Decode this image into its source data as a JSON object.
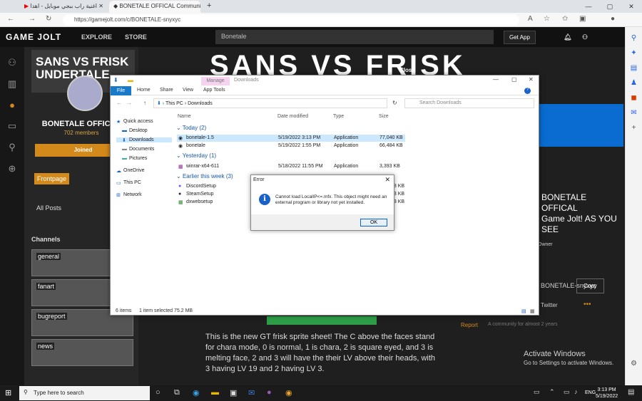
{
  "browser": {
    "tabs": [
      {
        "label": "اغنية راب ببجي موبايل - اهدا"
      },
      {
        "label": "BONETALE OFFICAL Community"
      }
    ],
    "url": "https://gamejolt.com/c/BONETALE-snyxyc",
    "new_tab": "+",
    "window_controls": [
      "—",
      "▢",
      "✕"
    ]
  },
  "gamejolt": {
    "logo": "GAME JOLT",
    "explore": "EXPLORE",
    "store": "STORE",
    "search_placeholder": "Bonetale",
    "get_app": "Get App",
    "channel_banner": "SANS VS FRISK UNDERTALE",
    "hero_banner": "SANS VS FRISK",
    "channel_name": "BONETALE OFFICAL",
    "members": "702 members",
    "joined": "Joined",
    "frontpage": "Frontpage",
    "all_posts": "All Posts",
    "channels_heading": "Channels",
    "channels": [
      "general",
      "fanart",
      "bugreport",
      "news"
    ],
    "close": "Close",
    "right_title": "BONETALE OFFICAL\nGame Jolt! AS YOU SEE",
    "owner": "Owner",
    "share_url": "BONETALE-snyxyc",
    "copy": "Copy",
    "twitter": "Twitter",
    "more": "•••",
    "report": "Report",
    "community_age": "A community for almost 2 years",
    "post_text": "This is the new GT frisk sprite sheet! The C above the faces stand for chara mode, 0 is normal, 1 is chara, 2 is square eyed, and 3 is melting face, 2 and 3 will have the their LV above their heads, with 3 having LV 19 and 2 having LV 3.",
    "activate_title": "Activate Windows",
    "activate_sub": "Go to Settings to activate Windows."
  },
  "explorer": {
    "context_tab": "Manage",
    "title": "Downloads",
    "ribbon": [
      "File",
      "Home",
      "Share",
      "View",
      "App Tools"
    ],
    "path": [
      "This PC",
      "Downloads"
    ],
    "search_placeholder": "Search Downloads",
    "nav": [
      {
        "label": "Quick access",
        "icon": "star-icon"
      },
      {
        "label": "Desktop",
        "icon": "folder-icon"
      },
      {
        "label": "Downloads",
        "icon": "download-icon",
        "selected": true
      },
      {
        "label": "Documents",
        "icon": "folder-icon"
      },
      {
        "label": "Pictures",
        "icon": "folder-icon"
      },
      {
        "label": "OneDrive",
        "icon": "cloud-icon"
      },
      {
        "label": "This PC",
        "icon": "computer-icon"
      },
      {
        "label": "Network",
        "icon": "network-icon"
      }
    ],
    "columns": [
      "Name",
      "Date modified",
      "Type",
      "Size"
    ],
    "groups": [
      {
        "label": "Today (2)",
        "files": [
          {
            "name": "bonetale-1.5",
            "date": "5/19/2022 3:13 PM",
            "type": "Application",
            "size": "77,040 KB",
            "selected": true
          },
          {
            "name": "bonetale",
            "date": "5/19/2022 1:55 PM",
            "type": "Application",
            "size": "66,484 KB"
          }
        ]
      },
      {
        "label": "Yesterday (1)",
        "files": [
          {
            "name": "winrar-x64-611",
            "date": "5/18/2022 11:55 PM",
            "type": "Application",
            "size": "3,393 KB"
          }
        ]
      },
      {
        "label": "Earlier this week (3)",
        "files": [
          {
            "name": "DiscordSetup",
            "date": "",
            "type": "",
            "size": "48 KB"
          },
          {
            "name": "SteamSetup",
            "date": "",
            "type": "",
            "size": "93 KB"
          },
          {
            "name": "dxwebsetup",
            "date": "",
            "type": "",
            "size": "93 KB"
          }
        ]
      }
    ],
    "status_items": "6 items",
    "status_selected": "1 item selected  75.2 MB"
  },
  "error": {
    "title": "Error",
    "message": "Cannot load LocalIP<=.mfx. This object might need an external program or library not yet installed.",
    "ok": "OK"
  },
  "taskbar": {
    "search_placeholder": "Type here to search",
    "lang": "ENG",
    "time": "3:13 PM",
    "date": "5/19/2022"
  }
}
